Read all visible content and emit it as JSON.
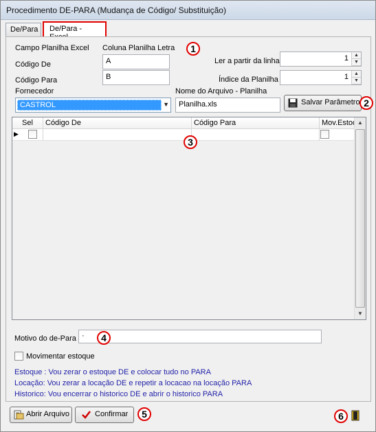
{
  "window": {
    "title": "Procedimento DE-PARA (Mudança de Código/ Substituição)"
  },
  "tabs": [
    {
      "label": "De/Para"
    },
    {
      "label": "De/Para - Excel"
    }
  ],
  "form": {
    "campo_planilha_label": "Campo Planilha Excel",
    "coluna_planilha_label": "Coluna Planilha Letra",
    "codigo_de_label": "Código De",
    "codigo_de_value": "A",
    "codigo_para_label": "Código Para",
    "codigo_para_value": "B",
    "ler_linha_label": "Ler a partir da linha",
    "ler_linha_value": "1",
    "indice_planilha_label": "Índice da Planilha",
    "indice_planilha_value": "1",
    "fornecedor_label": "Fornecedor",
    "fornecedor_value": "CASTROL",
    "arquivo_label": "Nome do Arquivo - Planilha",
    "arquivo_value": "Planilha.xls",
    "salvar_label": "Salvar Parâmetros"
  },
  "grid": {
    "columns": [
      "Sel",
      "Código De",
      "Código Para",
      "Mov.Estoque"
    ],
    "rows": [
      {
        "sel": false,
        "codigo_de": "",
        "codigo_para": "",
        "mov_estoque": false
      }
    ]
  },
  "motivo": {
    "label": "Motivo do de-Para",
    "value": "·"
  },
  "movimentar": {
    "label": "Movimentar estoque",
    "checked": false
  },
  "info_lines": [
    "Estoque : Vou zerar o estoque DE e colocar tudo no PARA",
    "Locação: Vou zerar a locação  DE e repetir a locacao na locação PARA",
    "Historico: Vou encerrar o historico DE e abrir o historico PARA"
  ],
  "buttons": {
    "abrir_label": "Abrir Arquivo",
    "confirmar_label": "Confirmar"
  },
  "badges": [
    "1",
    "2",
    "3",
    "4",
    "5",
    "6"
  ],
  "icons": {
    "salvar": "floppy-disk-icon",
    "abrir": "open-file-icon",
    "confirmar": "checkmark-icon",
    "exit": "exit-door-icon"
  },
  "colors": {
    "highlight": "#3399ff",
    "annotation": "#e00000",
    "info_text": "#1f1fa8"
  }
}
